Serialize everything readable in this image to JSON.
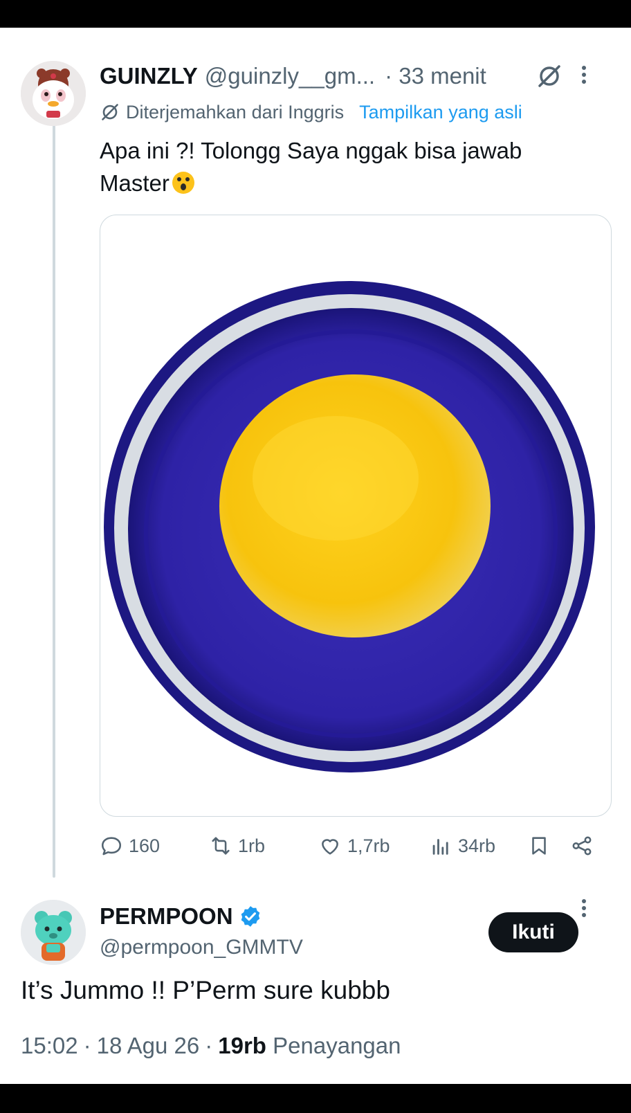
{
  "tweet": {
    "author_name": "GUINZLY",
    "author_handle": "@guinzly__gm...",
    "time": "· 33 menit",
    "translated_label": "Diterjemahkan dari Inggris",
    "show_original": "Tampilkan yang asli",
    "text_line1": "Apa ini ?! Tolongg Saya nggak bisa jawab",
    "text_line2": "Master",
    "emoji": "astonished-face-emoji",
    "image_description_icon": "plate-icon",
    "stats": {
      "replies": "160",
      "reposts": "1rb",
      "likes": "1,7rb",
      "views": "34rb"
    }
  },
  "reply": {
    "author_name": "PERMPOON",
    "author_handle": "@permpoon_GMMTV",
    "verified": true,
    "follow_label": "Ikuti",
    "text": "It’s Jummo !! P’Perm sure kubbb",
    "time": "15:02",
    "date": "18 Agu 26",
    "views_count": "19rb",
    "views_label": "Penayangan"
  },
  "colors": {
    "accent": "#1d9bf0",
    "text": "#0f1419",
    "muted": "#536471",
    "border": "#cfd9de"
  }
}
